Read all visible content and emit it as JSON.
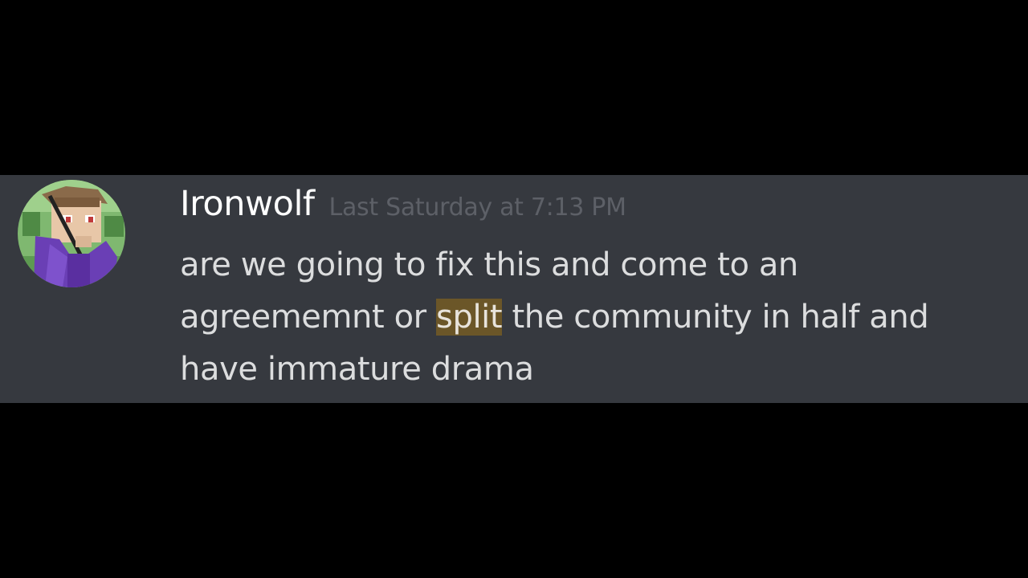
{
  "message": {
    "author": "Ironwolf",
    "timestamp": "Last Saturday at 7:13 PM",
    "lines": [
      {
        "text": "are we going to fix this and come to an"
      },
      {
        "before": "agreememnt or ",
        "highlight": "split",
        "after": " the community in half and"
      },
      {
        "text": "have immature drama"
      }
    ]
  },
  "colors": {
    "chat_background": "#36393f",
    "page_background": "#000000",
    "username": "#ffffff",
    "timestamp": "#5d6067",
    "message_text": "#dcddde",
    "highlight": "#6b5628"
  },
  "icons": {
    "avatar": "user-avatar-icon"
  }
}
